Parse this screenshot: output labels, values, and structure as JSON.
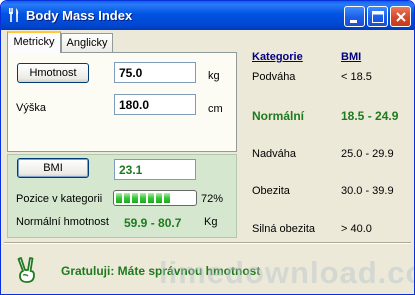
{
  "window": {
    "title": "Body Mass Index"
  },
  "tabs": [
    {
      "label": "Metricky"
    },
    {
      "label": "Anglicky"
    }
  ],
  "input": {
    "weight_button": "Hmotnost",
    "weight_value": "75.0",
    "weight_unit": "kg",
    "height_label": "Výška",
    "height_value": "180.0",
    "height_unit": "cm"
  },
  "result": {
    "bmi_button": "BMI",
    "bmi_value": "23.1",
    "position_label": "Pozice v kategorii",
    "position_percent": "72%",
    "position_fraction": 0.72,
    "normal_weight_label": "Normální hmotnost",
    "normal_weight_value": "59.9 - 80.7",
    "normal_weight_unit": "Kg"
  },
  "categories": {
    "header_category": "Kategorie",
    "header_bmi": "BMI",
    "rows": [
      {
        "name": "Podváha",
        "range": "< 18.5",
        "highlight": false
      },
      {
        "name": "Normální",
        "range": "18.5 - 24.9",
        "highlight": true
      },
      {
        "name": "Nadváha",
        "range": "25.0 - 29.9",
        "highlight": false
      },
      {
        "name": "Obezita",
        "range": "30.0 - 39.9",
        "highlight": false
      },
      {
        "name": "Silná obezita",
        "range": "> 40.0",
        "highlight": false
      }
    ]
  },
  "status": {
    "message": "Gratuluji: Máte správnou hmotnost",
    "icon": "victory-hand-icon"
  },
  "watermark": "limedownload.com",
  "colors": {
    "accent_green": "#1F7A1F",
    "header_blue": "#000080",
    "titlebar_blue": "#0054E3"
  }
}
